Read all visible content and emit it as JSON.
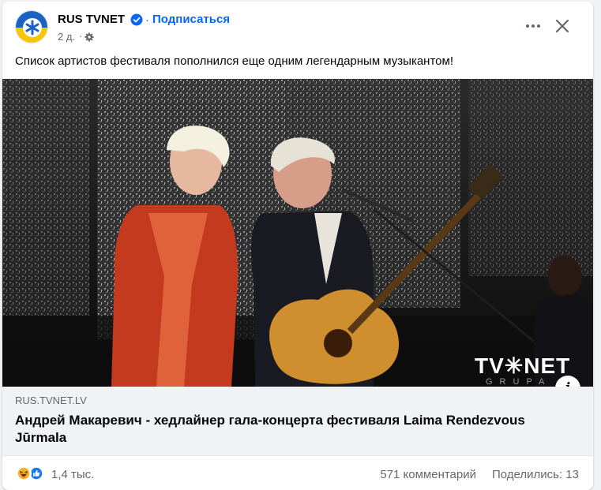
{
  "post": {
    "page_name": "RUS TVNET",
    "separator": "·",
    "subscribe_label": "Подписаться",
    "time": "2 д.",
    "time_separator": "·",
    "privacy_icon": "gear-icon",
    "text": "Список артистов фестиваля пополнился еще одним легендарным музыкантом!"
  },
  "image": {
    "watermark": "TV✳NET",
    "watermark_sub": "GRUPA",
    "info_label": "i"
  },
  "link": {
    "domain": "RUS.TVNET.LV",
    "title": "Андрей Макаревич - хедлайнер гала-концерта фестиваля Laima Rendezvous Jūrmala"
  },
  "footer": {
    "reactions_count": "1,4 тыс.",
    "comments": "571 комментарий",
    "shares": "Поделились: 13"
  },
  "colors": {
    "accent": "#0866ff",
    "secondary_text": "#65676b",
    "like_blue": "#1877f2",
    "haha_yellow": "#f7b125"
  }
}
